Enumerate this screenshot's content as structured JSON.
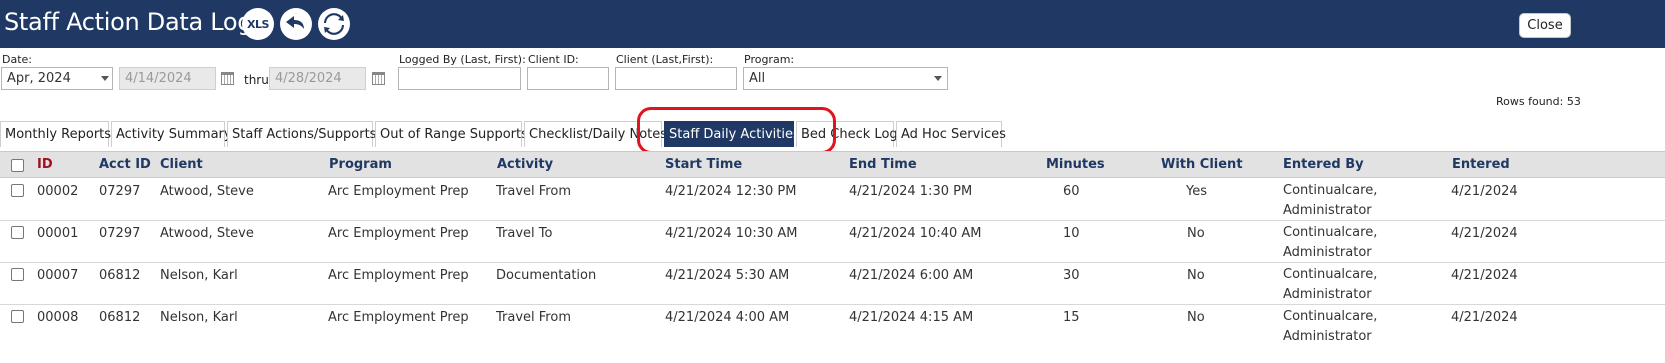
{
  "header": {
    "title": "Staff Action Data Log",
    "xls_label": "XLS",
    "close_label": "Close"
  },
  "filters": {
    "date_label": "Date:",
    "date_value": "Apr, 2024",
    "from_date": "4/14/2024",
    "thru_label": "thru",
    "to_date": "4/28/2024",
    "logged_by_label": "Logged By (Last, First):",
    "logged_by_value": "",
    "client_id_label": "Client ID:",
    "client_id_value": "",
    "client_name_label": "Client (Last,First):",
    "client_name_value": "",
    "program_label": "Program:",
    "program_value": "All"
  },
  "rows_found": "Rows found: 53",
  "tabs": [
    {
      "label": "Monthly Reports",
      "active": false
    },
    {
      "label": "Activity Summary",
      "active": false
    },
    {
      "label": "Staff Actions/Supports",
      "active": false
    },
    {
      "label": "Out of Range Supports",
      "active": false
    },
    {
      "label": "Checklist/Daily Notes",
      "active": false
    },
    {
      "label": "Staff Daily Activities",
      "active": true
    },
    {
      "label": "Bed Check Log",
      "active": false
    },
    {
      "label": "Ad Hoc Services",
      "active": false
    }
  ],
  "table": {
    "columns": [
      "ID",
      "Acct ID",
      "Client",
      "Program",
      "Activity",
      "Start Time",
      "End Time",
      "Minutes",
      "With Client",
      "Entered By",
      "Entered"
    ],
    "rows": [
      {
        "id": "00002",
        "acct_id": "07297",
        "client": "Atwood, Steve",
        "program": "Arc Employment Prep",
        "activity": "Travel From",
        "start": "4/21/2024 12:30 PM",
        "end": "4/21/2024 1:30 PM",
        "minutes": "60",
        "with_client": "Yes",
        "entered_by": "Continualcare, Administrator",
        "entered": "4/21/2024"
      },
      {
        "id": "00001",
        "acct_id": "07297",
        "client": "Atwood, Steve",
        "program": "Arc Employment Prep",
        "activity": "Travel To",
        "start": "4/21/2024 10:30 AM",
        "end": "4/21/2024 10:40 AM",
        "minutes": "10",
        "with_client": "No",
        "entered_by": "Continualcare, Administrator",
        "entered": "4/21/2024"
      },
      {
        "id": "00007",
        "acct_id": "06812",
        "client": "Nelson, Karl",
        "program": "Arc Employment Prep",
        "activity": "Documentation",
        "start": "4/21/2024 5:30 AM",
        "end": "4/21/2024 6:00 AM",
        "minutes": "30",
        "with_client": "No",
        "entered_by": "Continualcare, Administrator",
        "entered": "4/21/2024"
      },
      {
        "id": "00008",
        "acct_id": "06812",
        "client": "Nelson, Karl",
        "program": "Arc Employment Prep",
        "activity": "Travel From",
        "start": "4/21/2024 4:00 AM",
        "end": "4/21/2024 4:15 AM",
        "minutes": "15",
        "with_client": "No",
        "entered_by": "Continualcare, Administrator",
        "entered": "4/21/2024"
      }
    ]
  },
  "colors": {
    "header_bg": "#1f3864",
    "active_tab_bg": "#1f3864",
    "highlight_ring": "#e0141e",
    "id_header": "#a01020"
  },
  "icons": {
    "xls": "xls-export-icon",
    "undo": "undo-arrow-icon",
    "refresh": "refresh-icon",
    "calendar": "calendar-icon",
    "dropdown": "chevron-down-icon"
  }
}
